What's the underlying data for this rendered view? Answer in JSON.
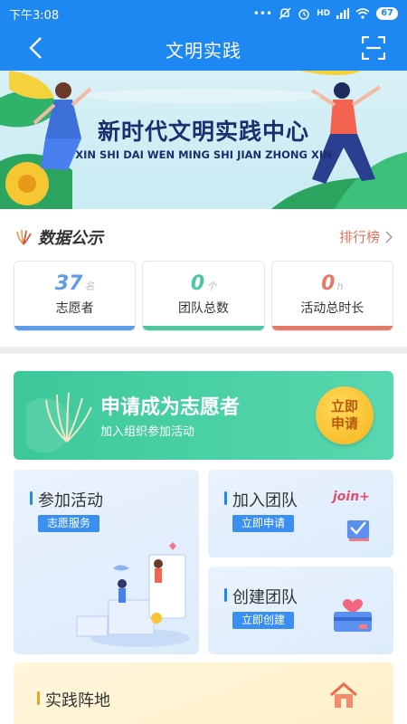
{
  "status_bar": {
    "time": "下午3:08",
    "network": "HD",
    "battery": "67"
  },
  "header": {
    "title": "文明实践"
  },
  "banner": {
    "title": "新时代文明实践中心",
    "subtitle": "XIN SHI DAI WEN MING SHI JIAN ZHONG XIN"
  },
  "data_section": {
    "title": "数据公示",
    "ranking_label": "排行榜",
    "stats": [
      {
        "value": "37",
        "unit": "名",
        "caption": "志愿者",
        "color": "#5e9de8"
      },
      {
        "value": "0",
        "unit": "个",
        "caption": "团队总数",
        "color": "#4ec7a0"
      },
      {
        "value": "0",
        "unit": "h",
        "caption": "活动总时长",
        "color": "#e57b67"
      }
    ]
  },
  "volunteer": {
    "title": "申请成为志愿者",
    "subtitle": "加入组织参加活动",
    "button_label": "立即申请"
  },
  "cards": {
    "activity": {
      "title": "参加活动",
      "tag": "志愿服务"
    },
    "join_team": {
      "title": "加入团队",
      "tag": "立即申请",
      "badge": "join+"
    },
    "create_team": {
      "title": "创建团队",
      "tag": "立即创建"
    },
    "base": {
      "title": "实践阵地"
    }
  },
  "colors": {
    "primary": "#1e88f2",
    "green": "#3cc89a",
    "accent": "#e0755f"
  }
}
